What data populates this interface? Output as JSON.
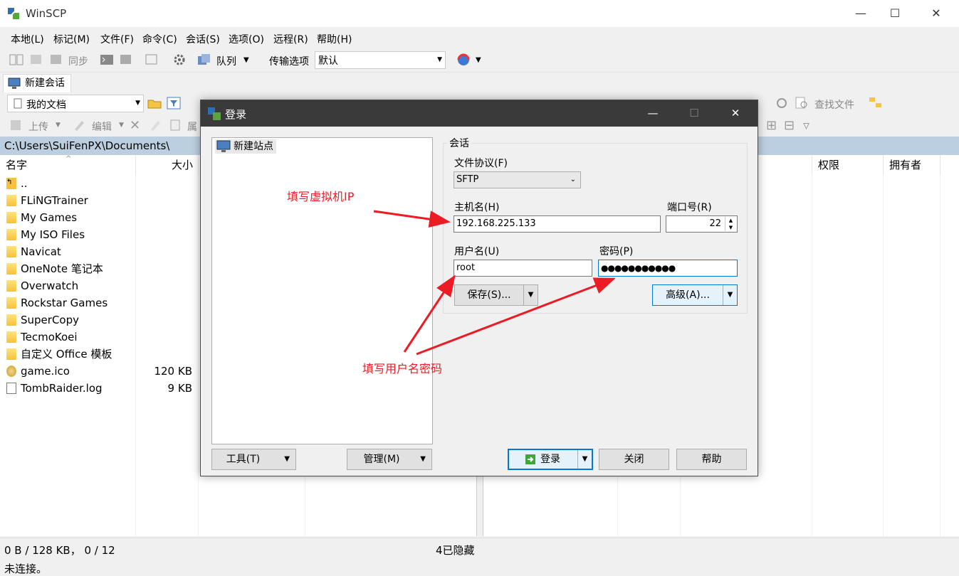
{
  "app": {
    "title": "WinSCP"
  },
  "window_controls": {
    "minimize": "—",
    "maximize": "☐",
    "close": "✕"
  },
  "menu": [
    "本地(L)",
    "标记(M)",
    "文件(F)",
    "命令(C)",
    "会话(S)",
    "选项(O)",
    "远程(R)",
    "帮助(H)"
  ],
  "toolbar": {
    "sync_label": "同步",
    "queue_label": "队列",
    "transfer_label": "传输选项",
    "transfer_value": "默认"
  },
  "tab": {
    "new_session": "新建会话"
  },
  "local_toolbar": {
    "location": "我的文档",
    "upload": "上传",
    "edit": "编辑",
    "props": "属"
  },
  "remote_toolbar": {
    "find_files": "查找文件"
  },
  "local_path": "C:\\Users\\SuiFenPX\\Documents\\",
  "local_columns": {
    "name": "名字",
    "size": "大小"
  },
  "remote_columns": {
    "perms": "权限",
    "owner": "拥有者"
  },
  "files": [
    {
      "name": "..",
      "size": "",
      "type": "up"
    },
    {
      "name": "FLiNGTrainer",
      "size": "",
      "type": "folder"
    },
    {
      "name": "My Games",
      "size": "",
      "type": "folder"
    },
    {
      "name": "My ISO Files",
      "size": "",
      "type": "folder"
    },
    {
      "name": "Navicat",
      "size": "",
      "type": "folder"
    },
    {
      "name": "OneNote 笔记本",
      "size": "",
      "type": "folder"
    },
    {
      "name": "Overwatch",
      "size": "",
      "type": "folder"
    },
    {
      "name": "Rockstar Games",
      "size": "",
      "type": "folder"
    },
    {
      "name": "SuperCopy",
      "size": "",
      "type": "folder"
    },
    {
      "name": "TecmoKoei",
      "size": "",
      "type": "folder"
    },
    {
      "name": "自定义 Office 模板",
      "size": "",
      "type": "folder"
    },
    {
      "name": "game.ico",
      "size": "120 KB",
      "type": "ico"
    },
    {
      "name": "TombRaider.log",
      "size": "9 KB",
      "type": "log"
    }
  ],
  "status": {
    "selection": "0 B / 128 KB， 0 / 12",
    "hidden": "4已隐藏",
    "connection": "未连接。"
  },
  "dialog": {
    "title": "登录",
    "site_item": "新建站点",
    "session_group": "会话",
    "protocol_label": "文件协议(F)",
    "protocol_value": "SFTP",
    "host_label": "主机名(H)",
    "host_value": "192.168.225.133",
    "port_label": "端口号(R)",
    "port_value": "22",
    "user_label": "用户名(U)",
    "user_value": "root",
    "pass_label": "密码(P)",
    "pass_value": "●●●●●●●●●●●",
    "save_button": "保存(S)...",
    "advanced_button": "高级(A)...",
    "tools_button": "工具(T)",
    "manage_button": "管理(M)",
    "login_button": "登录",
    "close_button": "关闭",
    "help_button": "帮助"
  },
  "annotations": {
    "ip": "填写虚拟机IP",
    "user_pass": "填写用户名密码"
  },
  "colors": {
    "accent": "#0078d7",
    "annotation": "#ec1c24",
    "path_bar": "#bccfe0",
    "dialog_title": "#3a3a3a"
  }
}
